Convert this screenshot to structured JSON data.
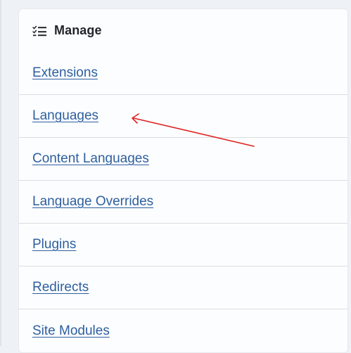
{
  "panel": {
    "title": "Manage",
    "icon": "checklist-icon"
  },
  "menu": {
    "items": [
      {
        "label": "Extensions"
      },
      {
        "label": "Languages"
      },
      {
        "label": "Content Languages"
      },
      {
        "label": "Language Overrides"
      },
      {
        "label": "Plugins"
      },
      {
        "label": "Redirects"
      },
      {
        "label": "Site Modules"
      }
    ]
  },
  "annotation": {
    "arrow_color": "#e02020",
    "points_to": "Languages"
  },
  "colors": {
    "link": "#2d5f9f",
    "heading": "#22262a",
    "background": "#eef1f5",
    "panel": "#fcfdfe"
  }
}
